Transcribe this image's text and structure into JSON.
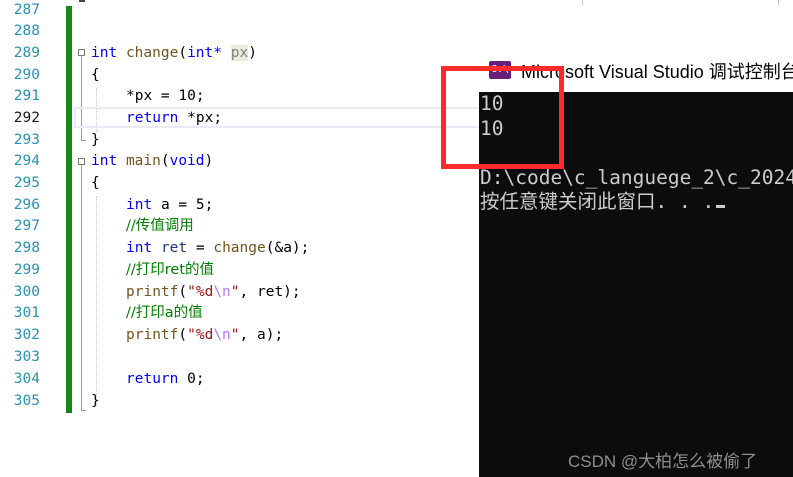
{
  "editor": {
    "line_numbers": [
      "287",
      "288",
      "289",
      "290",
      "291",
      "292",
      "293",
      "294",
      "295",
      "296",
      "297",
      "298",
      "299",
      "300",
      "301",
      "302",
      "303",
      "304",
      "305"
    ],
    "current_line": "292",
    "code": {
      "l289": {
        "kw": "int",
        "fn": "change",
        "open": "(",
        "ptype": "int*",
        "param": "px",
        "close": ")"
      },
      "l290": "{",
      "l291": "*px = 10;",
      "l292": {
        "kw": "return",
        "rest": "*px;"
      },
      "l293": "}",
      "l294": {
        "kw": "int",
        "fn": "main",
        "open": "(",
        "ptype": "void",
        "close": ")"
      },
      "l295": "{",
      "l296": {
        "kw": "int",
        "rest": "a = 5;"
      },
      "l297": "//传值调用",
      "l298": {
        "kw": "int",
        "var": "ret",
        "eq": " = ",
        "fn": "change",
        "args": "(&a);"
      },
      "l299": "//打印ret的值",
      "l300": {
        "fn": "printf",
        "open": "(",
        "str_a": "\"%d",
        "esc": "\\n",
        "str_b": "\"",
        "rest": ", ret);"
      },
      "l301": "//打印a的值",
      "l302": {
        "fn": "printf",
        "open": "(",
        "str_a": "\"%d",
        "esc": "\\n",
        "str_b": "\"",
        "rest": ", a);"
      },
      "l304": {
        "kw": "return",
        "rest": "0;"
      },
      "l305": "}"
    }
  },
  "console": {
    "title": "Microsoft Visual Studio 调试控制台",
    "icon_label": "C:\\",
    "lines": [
      "10",
      "10",
      "",
      "D:\\code\\c_languege_2\\c_2024",
      "按任意键关闭此窗口. . ."
    ]
  },
  "watermark": "CSDN @大柏怎么被偷了",
  "colors": {
    "highlight_box": "#ff2a2a",
    "change_bar": "#148a14",
    "keyword": "#0000ff",
    "comment": "#008000",
    "console_bg": "#0c0c0c"
  }
}
